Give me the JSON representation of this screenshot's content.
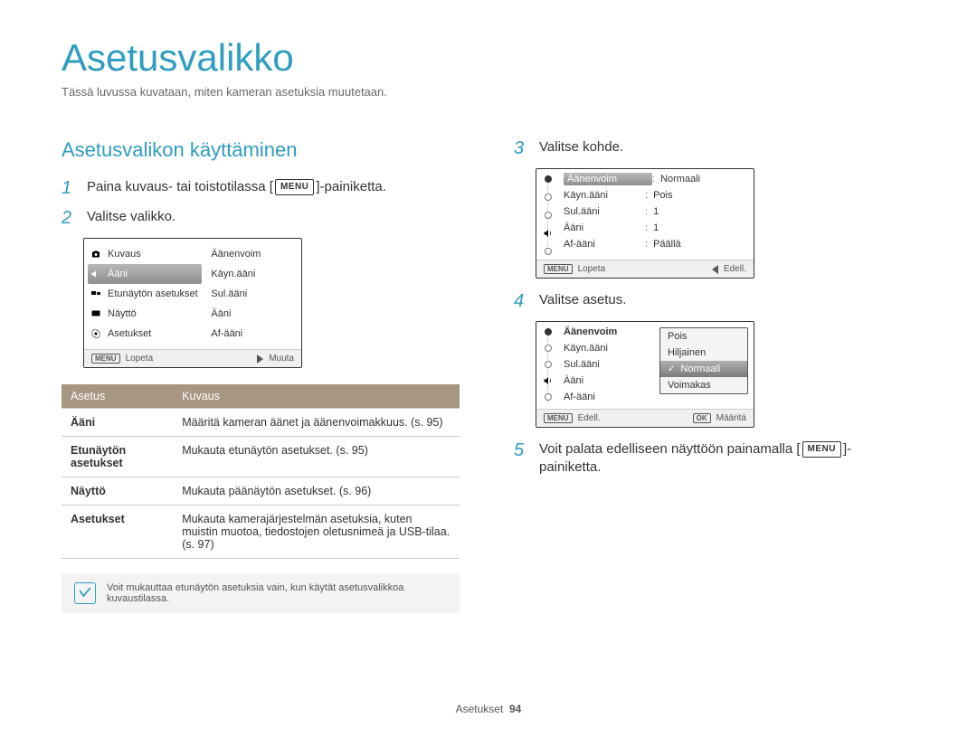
{
  "title": "Asetusvalikko",
  "intro": "Tässä luvussa kuvataan, miten kameran asetuksia muutetaan.",
  "section_title": "Asetusvalikon käyttäminen",
  "steps": {
    "n1": "1",
    "s1_pre": "Paina kuvaus- tai toistotilassa [",
    "s1_menu": "MENU",
    "s1_post": "]-painiketta.",
    "n2": "2",
    "s2": "Valitse valikko.",
    "n3": "3",
    "s3": "Valitse kohde.",
    "n4": "4",
    "s4": "Valitse asetus.",
    "n5": "5",
    "s5_pre": "Voit palata edelliseen näyttöön painamalla [",
    "s5_menu": "MENU",
    "s5_post": "]-painiketta."
  },
  "screen2": {
    "left": [
      "Kuvaus",
      "Ääni",
      "Etunäytön asetukset",
      "Näyttö",
      "Asetukset"
    ],
    "selected_index": 1,
    "right": [
      "Äänenvoim",
      "Käyn.ääni",
      "Sul.ääni",
      "Ääni",
      "Af-ääni"
    ],
    "foot_left_badge": "MENU",
    "foot_left": "Lopeta",
    "foot_right": "Muuta"
  },
  "table": {
    "h1": "Asetus",
    "h2": "Kuvaus",
    "rows": [
      {
        "k": "Ääni",
        "v": "Määritä kameran äänet ja äänenvoimakkuus. (s. 95)"
      },
      {
        "k": "Etunäytön asetukset",
        "v": "Mukauta etunäytön asetukset. (s. 95)"
      },
      {
        "k": "Näyttö",
        "v": "Mukauta päänäytön asetukset. (s. 96)"
      },
      {
        "k": "Asetukset",
        "v": "Mukauta kamerajärjestelmän asetuksia, kuten muistin muotoa, tiedostojen oletusnimeä ja USB-tilaa. (s. 97)"
      }
    ]
  },
  "note": {
    "icon": "✓",
    "text": "Voit mukauttaa etunäytön asetuksia vain, kun käytät asetusvalikkoa kuvaustilassa."
  },
  "screen3": {
    "rows": [
      {
        "label": "Äänenvoim",
        "val": "Normaali",
        "selected": true
      },
      {
        "label": "Käyn.ääni",
        "val": "Pois"
      },
      {
        "label": "Sul.ääni",
        "val": "1"
      },
      {
        "label": "Ääni",
        "val": "1",
        "speaker": true
      },
      {
        "label": "Af-ääni",
        "val": "Päällä"
      }
    ],
    "foot_left_badge": "MENU",
    "foot_left": "Lopeta",
    "foot_right": "Edell."
  },
  "screen4": {
    "rows": [
      "Äänenvoim",
      "Käyn.ääni",
      "Sul.ääni",
      "Ääni",
      "Af-ääni"
    ],
    "options": [
      "Pois",
      "Hiljainen",
      "Normaali",
      "Voimakas"
    ],
    "selected_option_index": 2,
    "foot_left_badge": "MENU",
    "foot_left": "Edell.",
    "foot_right_badge": "OK",
    "foot_right": "Määritä"
  },
  "footer": {
    "label": "Asetukset",
    "page": "94"
  }
}
